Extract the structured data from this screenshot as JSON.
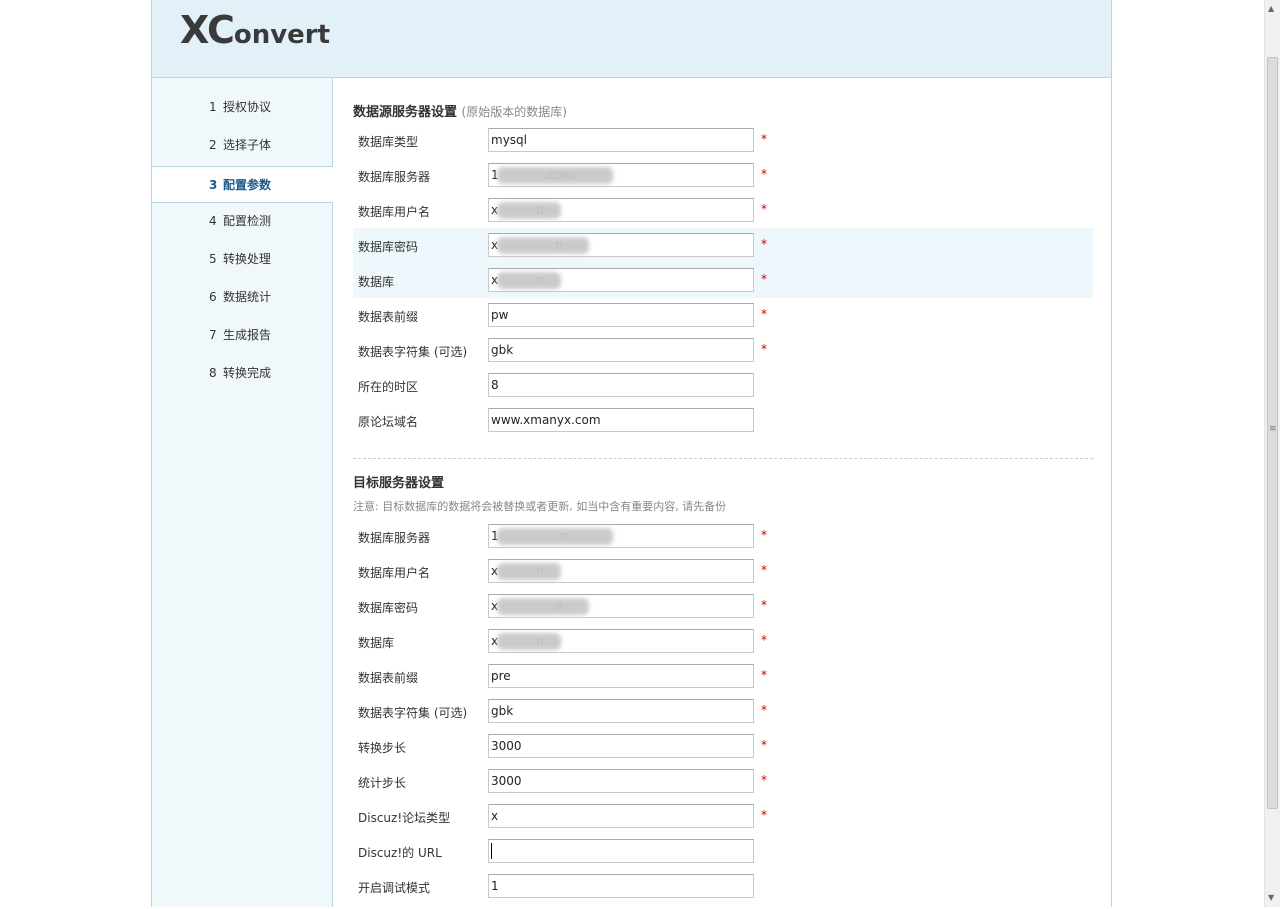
{
  "logo": {
    "x": "X",
    "c": "C",
    "rest": "onvert"
  },
  "steps": [
    {
      "num": "1",
      "label": "授权协议"
    },
    {
      "num": "2",
      "label": "选择子体"
    },
    {
      "num": "3",
      "label": "配置参数"
    },
    {
      "num": "4",
      "label": "配置检测"
    },
    {
      "num": "5",
      "label": "转换处理"
    },
    {
      "num": "6",
      "label": "数据统计"
    },
    {
      "num": "7",
      "label": "生成报告"
    },
    {
      "num": "8",
      "label": "转换完成"
    }
  ],
  "source": {
    "title": "数据源服务器设置",
    "subtitle": "(原始版本的数据库)",
    "required_mark": "*",
    "fields": [
      {
        "label": "数据库类型",
        "value": "mysql"
      },
      {
        "label": "数据库服务器",
        "value": "1            .com"
      },
      {
        "label": "数据库用户名",
        "value": "x          n"
      },
      {
        "label": "数据库密码",
        "value": "x               n"
      },
      {
        "label": "数据库",
        "value": "x          n"
      },
      {
        "label": "数据表前缀",
        "value": "pw"
      },
      {
        "label": "数据表字符集 (可选)",
        "value": "gbk"
      },
      {
        "label": "所在的时区",
        "value": "8"
      },
      {
        "label": "原论坛域名",
        "value": "www.xmanyx.com"
      }
    ]
  },
  "target": {
    "title": "目标服务器设置",
    "note": "注意: 目标数据库的数据将会被替换或者更新, 如当中含有重要内容, 请先备份",
    "required_mark": "*",
    "fields": [
      {
        "label": "数据库服务器",
        "value": "1                n"
      },
      {
        "label": "数据库用户名",
        "value": "x          n"
      },
      {
        "label": "数据库密码",
        "value": "x               n"
      },
      {
        "label": "数据库",
        "value": "x          n"
      },
      {
        "label": "数据表前缀",
        "value": "pre"
      },
      {
        "label": "数据表字符集 (可选)",
        "value": "gbk"
      },
      {
        "label": "转换步长",
        "value": "3000"
      },
      {
        "label": "统计步长",
        "value": "3000"
      },
      {
        "label": "Discuz!论坛类型",
        "value": "x"
      },
      {
        "label": "Discuz!的 URL",
        "value": ""
      },
      {
        "label": "开启调试模式",
        "value": "1"
      }
    ]
  },
  "scrollbar": {
    "up": "▲",
    "down": "▼",
    "grip": "≡"
  }
}
